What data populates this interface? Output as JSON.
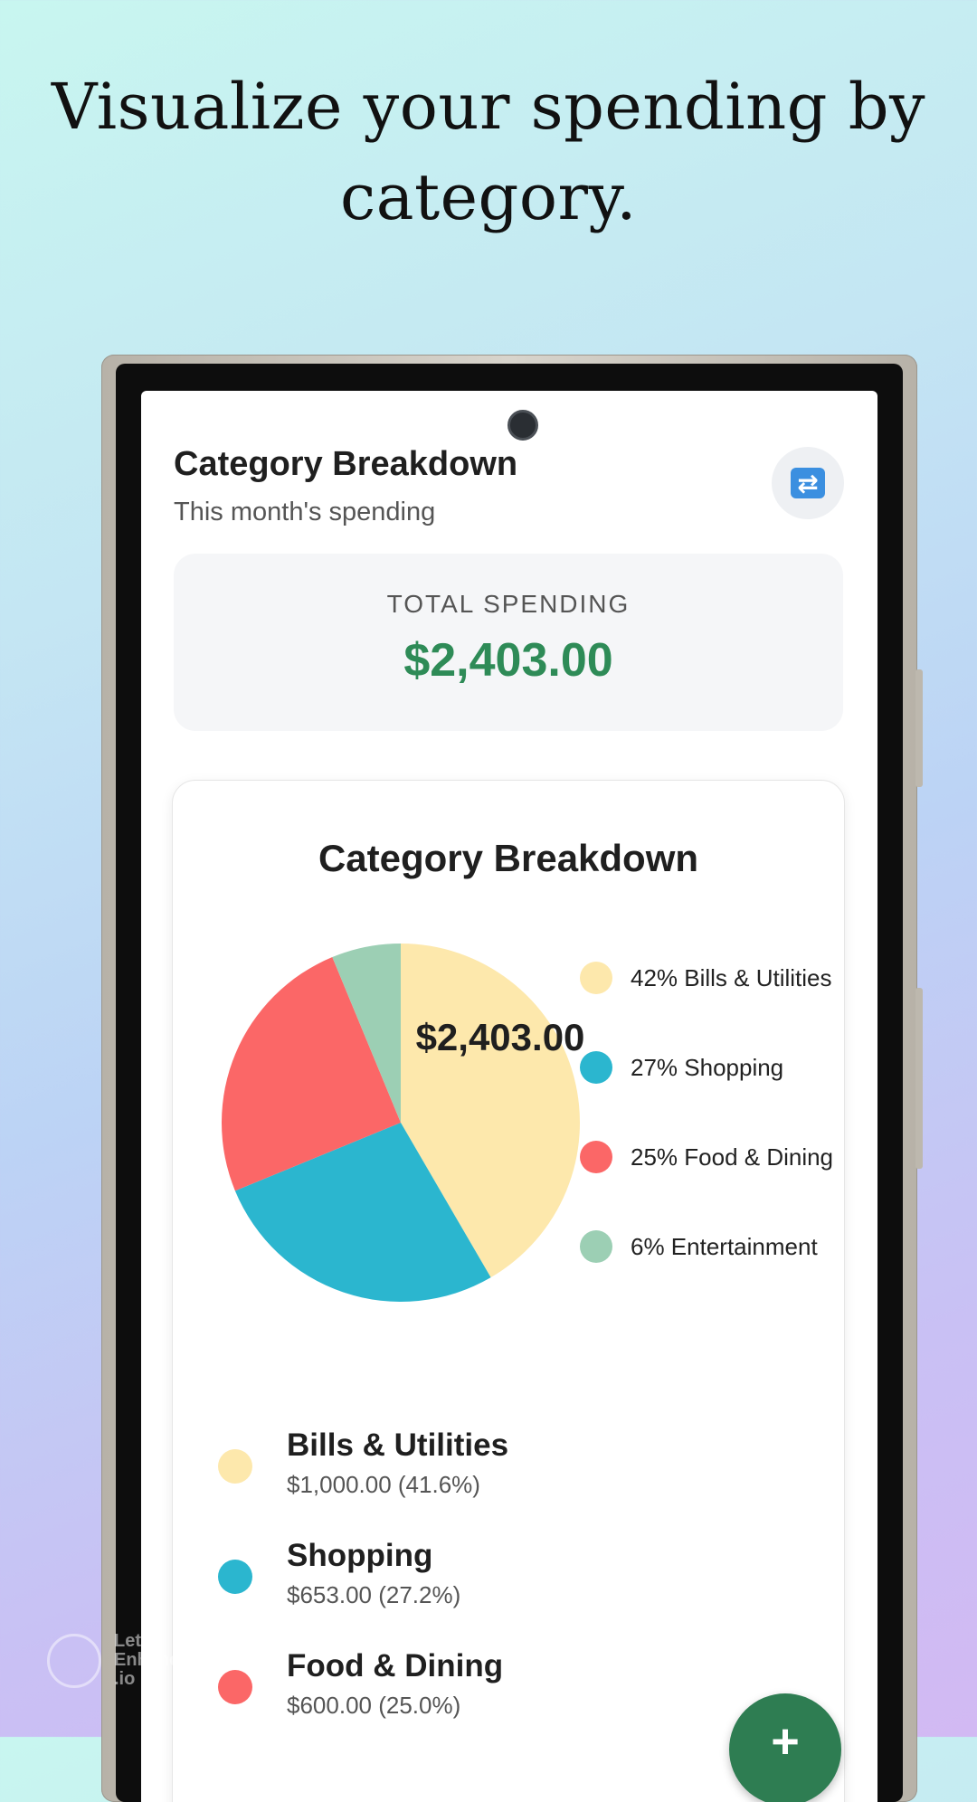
{
  "headline": "Visualize your spending by category.",
  "header": {
    "title": "Category Breakdown",
    "subtitle": "This month's spending",
    "refresh_icon": "refresh-icon"
  },
  "total": {
    "label": "TOTAL SPENDING",
    "value": "$2,403.00"
  },
  "chart_card": {
    "title": "Category Breakdown"
  },
  "chart_data": {
    "type": "pie",
    "title": "Category Breakdown",
    "center_label": "$2,403.00",
    "slices": [
      {
        "label": "42% Bills & Utilities",
        "value": 1000.0,
        "color": "#fde8ac"
      },
      {
        "label": "27% Shopping",
        "value": 653.0,
        "color": "#2bb6cf"
      },
      {
        "label": "25% Food & Dining",
        "value": 600.0,
        "color": "#fb6767"
      },
      {
        "label": "6% Entertainment",
        "value": 150.0,
        "color": "#9ccfb4"
      }
    ]
  },
  "list": [
    {
      "name": "Bills & Utilities",
      "amount": "$1,000.00 (41.6%)",
      "color": "#fde8ac"
    },
    {
      "name": "Shopping",
      "amount": "$653.00 (27.2%)",
      "color": "#2bb6cf"
    },
    {
      "name": "Food & Dining",
      "amount": "$600.00 (25.0%)",
      "color": "#fb6767"
    }
  ],
  "fab": {
    "label": "+"
  },
  "watermark": {
    "line1": "Let's",
    "line2": "Enhance",
    "line3": ".io"
  }
}
